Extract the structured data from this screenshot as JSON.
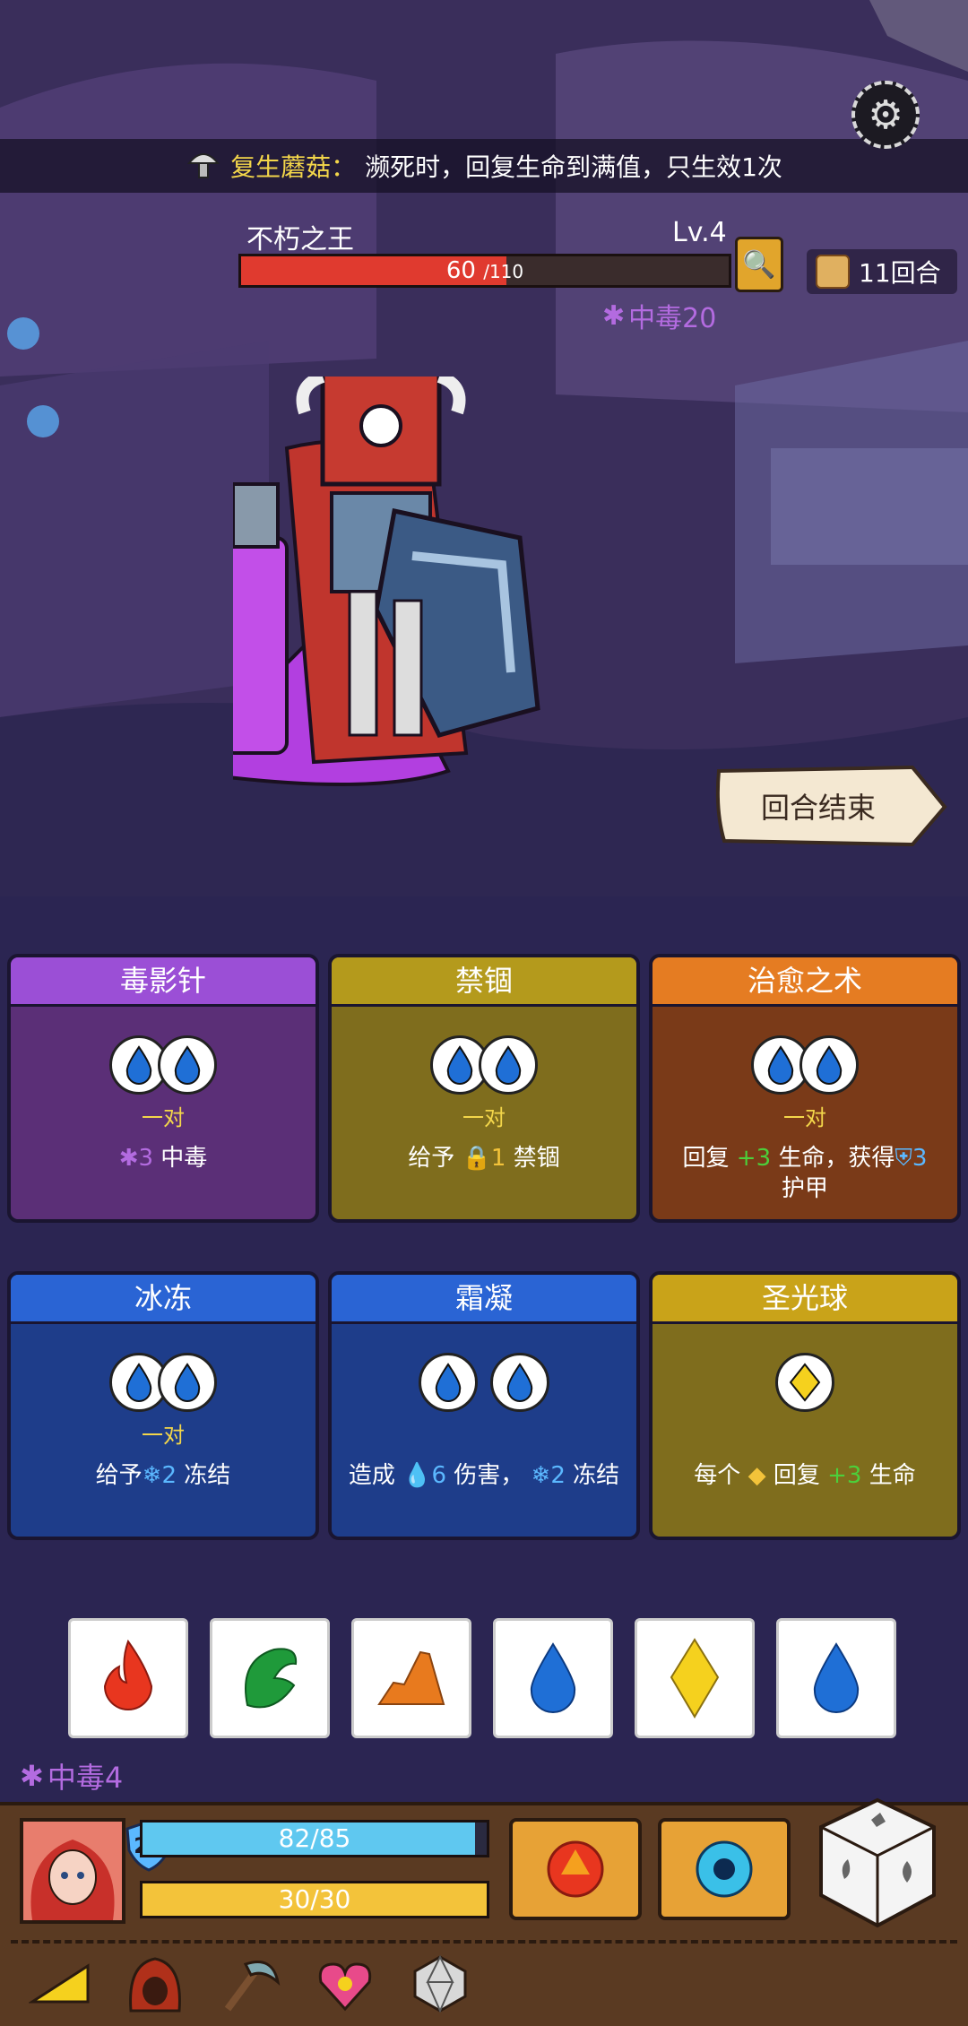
{
  "banner": {
    "item_name": "复生蘑菇：",
    "effect": "濒死时，回复生命到满值，只生效1次"
  },
  "enemy": {
    "name": "不朽之王",
    "level": "Lv.4",
    "hp_current": "60",
    "hp_max": "/110",
    "hp_fraction": 0.545,
    "status_label": "中毒20"
  },
  "turn_counter": "11回合",
  "end_turn_label": "回合结束",
  "cards": [
    {
      "title": "毒影针",
      "pair_label": "一对",
      "desc_amount": "3",
      "desc_text": "中毒",
      "theme": "purple"
    },
    {
      "title": "禁锢",
      "pair_label": "一对",
      "desc_prefix": "给予",
      "desc_amount": "1",
      "desc_text": "禁锢",
      "theme": "olive"
    },
    {
      "title": "治愈之术",
      "pair_label": "一对",
      "desc_prefix": "回复",
      "desc_heal": "+3",
      "desc_mid": "生命，获得",
      "desc_armor": "3",
      "desc_suffix": "护甲",
      "theme": "orange"
    },
    {
      "title": "冰冻",
      "pair_label": "一对",
      "desc_prefix": "给予",
      "desc_amount": "2",
      "desc_text": "冻结",
      "theme": "blue"
    },
    {
      "title": "霜凝",
      "pair_label": "",
      "desc_prefix": "造成",
      "desc_damage": "6",
      "desc_mid": "伤害，",
      "desc_amount": "2",
      "desc_text": "冻结",
      "theme": "blue"
    },
    {
      "title": "圣光球",
      "pair_label": "",
      "desc_prefix": "每个",
      "desc_mid": "回复",
      "desc_heal": "+3",
      "desc_text": "生命",
      "theme": "gold"
    }
  ],
  "dice": [
    {
      "icon": "fire-icon",
      "color": "#e8361f"
    },
    {
      "icon": "leaf-icon",
      "color": "#1f9a3a"
    },
    {
      "icon": "rock-icon",
      "color": "#e87a1e"
    },
    {
      "icon": "water-drop-icon",
      "color": "#1f6fd6"
    },
    {
      "icon": "diamond-icon",
      "color": "#f5d11e"
    },
    {
      "icon": "water-drop-icon",
      "color": "#1f6fd6"
    }
  ],
  "player": {
    "status_label": "中毒4",
    "level": "26",
    "hp": "82/85",
    "hp_fraction": 0.965,
    "energy": "30/30",
    "energy_fraction": 1.0
  },
  "colors": {
    "poison": "#b36be0",
    "heal": "#4ccf3b",
    "armor": "#5bb8ff",
    "hp_bar": "#e03a2f",
    "player_hp": "#5fc8f0",
    "player_energy": "#f3c33a"
  }
}
